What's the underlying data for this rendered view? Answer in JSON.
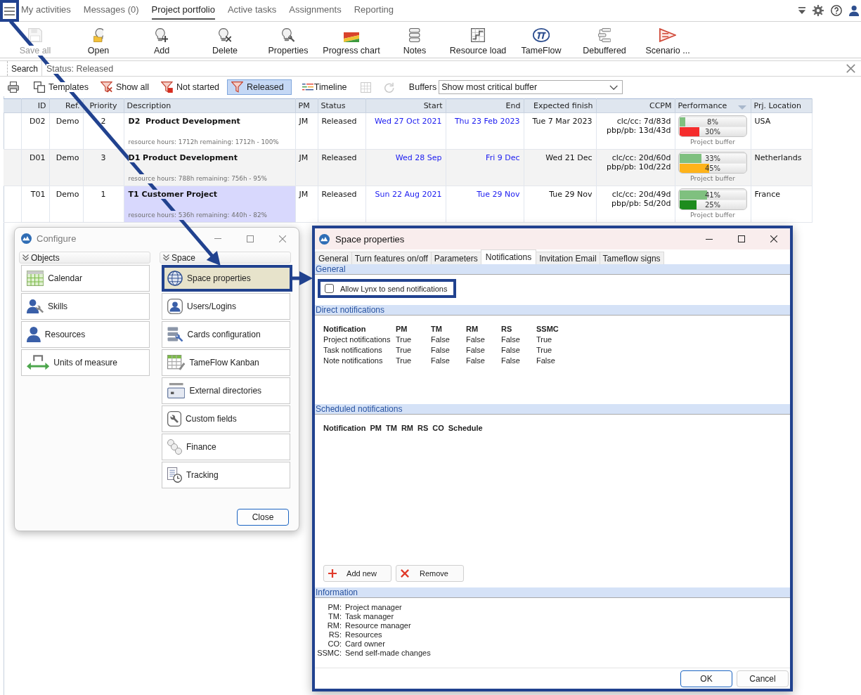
{
  "nav": {
    "menu_highlighted": true,
    "tabs": [
      {
        "label": "My activities",
        "selected": false
      },
      {
        "label": "Messages (0)",
        "selected": false
      },
      {
        "label": "Project portfolio",
        "selected": true
      },
      {
        "label": "Active tasks",
        "selected": false
      },
      {
        "label": "Assignments",
        "selected": false
      },
      {
        "label": "Reporting",
        "selected": false
      }
    ]
  },
  "toolbar": [
    {
      "kind": "save",
      "label": "Save all",
      "disabled": true
    },
    {
      "kind": "open",
      "label": "Open",
      "disabled": false
    },
    {
      "kind": "add",
      "label": "Add",
      "disabled": false
    },
    {
      "kind": "delete",
      "label": "Delete",
      "disabled": false
    },
    {
      "kind": "properties",
      "label": "Properties",
      "disabled": false
    },
    {
      "kind": "progress",
      "label": "Progress chart",
      "disabled": false
    },
    {
      "kind": "notes",
      "label": "Notes",
      "disabled": false
    },
    {
      "kind": "load",
      "label": "Resource load",
      "disabled": false
    },
    {
      "kind": "tameflow",
      "label": "TameFlow",
      "disabled": false
    },
    {
      "kind": "debuffered",
      "label": "Debuffered",
      "disabled": false
    },
    {
      "kind": "scenario",
      "label": "Scenario ...",
      "disabled": false
    }
  ],
  "search_bar": {
    "tab": "Search",
    "filter": "Status: Released"
  },
  "filter_bar": {
    "filters": [
      {
        "kind": "templates",
        "label": "Templates",
        "selected": false
      },
      {
        "kind": "show_all",
        "label": "Show all",
        "selected": false
      },
      {
        "kind": "not_started",
        "label": "Not started",
        "selected": false
      },
      {
        "kind": "released",
        "label": "Released",
        "selected": true
      }
    ],
    "views": [
      {
        "kind": "timeline",
        "label": "Timeline",
        "disabled": false
      },
      {
        "kind": "grid",
        "disabled": true
      },
      {
        "kind": "week",
        "disabled": true
      }
    ],
    "buffers": {
      "label": "Buffers",
      "value": "Show most critical buffer"
    }
  },
  "table": {
    "columns": [
      {
        "label": "ID",
        "sorted": false
      },
      {
        "label": "Ref.",
        "sorted": false
      },
      {
        "label": "Priority",
        "sorted": false
      },
      {
        "label": "Description",
        "sorted": false
      },
      {
        "label": "PM",
        "sorted": false
      },
      {
        "label": "Status",
        "sorted": false
      },
      {
        "label": "Start",
        "sorted": false
      },
      {
        "label": "End",
        "sorted": false
      },
      {
        "label": "Expected finish",
        "sorted": false
      },
      {
        "label": "CCPM",
        "sorted": false
      },
      {
        "label": "Performance",
        "sorted": true
      },
      {
        "label": "Prj. Location",
        "sorted": false
      }
    ],
    "rows": [
      {
        "selected": false,
        "id": "D02",
        "ref": "Demo",
        "priority": "2",
        "title": "D2  Product Development",
        "details": "resource hours: 1712h remaining: 1712h - 100%",
        "pm": "JM",
        "status": "Released",
        "start": "Wed 27 Oct 2021",
        "end": "Thu 23 Feb 2023",
        "expected_finish": "Tue 7 Mar 2023",
        "ccpm": [
          "clc/cc: 7d/83d",
          "pbp/pb: 13d/43d"
        ],
        "performance": {
          "progress": {
            "level": 0.08,
            "label": "8%"
          },
          "buffer": {
            "level": 0.3,
            "label": "30%",
            "color": "#f52d2d"
          },
          "caption": "Project buffer"
        },
        "location": "USA"
      },
      {
        "selected": false,
        "id": "D01",
        "ref": "Demo",
        "priority": "3",
        "title": "D1 Product Development",
        "details": "resource hours: 788h remaining: 756h - 95%",
        "pm": "JM",
        "status": "Released",
        "start": "Wed 28 Sep",
        "end": "Fri 9 Dec",
        "expected_finish": "Wed 21 Dec",
        "ccpm": [
          "clc/cc: 20d/60d",
          "pbp/pb: 10d/22d"
        ],
        "performance": {
          "progress": {
            "level": 0.33,
            "label": "33%"
          },
          "buffer": {
            "level": 0.45,
            "label": "45%",
            "color": "#ffb31a"
          },
          "caption": "Project buffer"
        },
        "location": "Netherlands"
      },
      {
        "selected": true,
        "id": "T01",
        "ref": "Demo",
        "priority": "1",
        "title": "T1 Customer Project",
        "details": "resource hours: 536h remaining: 440h - 82%",
        "pm": "JM",
        "status": "Released",
        "start": "Sun 22 Aug 2021",
        "end": "Tue 29 Nov",
        "expected_finish": "Tue 29 Nov",
        "ccpm": [
          "clc/cc: 20d/49d",
          "pbp/pb: 5d/20d"
        ],
        "performance": {
          "progress": {
            "level": 0.41,
            "label": "41%"
          },
          "buffer": {
            "level": 0.25,
            "label": "25%",
            "color": "#1e8c1e"
          },
          "caption": "Project buffer"
        },
        "location": "France"
      }
    ]
  },
  "configure": {
    "title": "Configure",
    "groups": [
      {
        "label": "Objects",
        "items": [
          {
            "kind": "calendar",
            "label": "Calendar",
            "selected": false,
            "highlighted": false
          },
          {
            "kind": "skills",
            "label": "Skills",
            "selected": false,
            "highlighted": false
          },
          {
            "kind": "resources",
            "label": "Resources",
            "selected": false,
            "highlighted": false
          },
          {
            "kind": "units",
            "label": "Units of measure",
            "selected": false,
            "highlighted": false
          }
        ]
      },
      {
        "label": "Space",
        "items": [
          {
            "kind": "globe",
            "label": "Space properties",
            "selected": true,
            "highlighted": true
          },
          {
            "kind": "users",
            "label": "Users/Logins",
            "selected": false,
            "highlighted": false
          },
          {
            "kind": "cards",
            "label": "Cards configuration",
            "selected": false,
            "highlighted": false
          },
          {
            "kind": "kanban",
            "label": "TameFlow Kanban",
            "selected": false,
            "highlighted": false
          },
          {
            "kind": "directories",
            "label": "External directories",
            "selected": false,
            "highlighted": false
          },
          {
            "kind": "fields",
            "label": "Custom fields",
            "selected": false,
            "highlighted": false
          },
          {
            "kind": "finance",
            "label": "Finance",
            "selected": false,
            "highlighted": false
          },
          {
            "kind": "tracking",
            "label": "Tracking",
            "selected": false,
            "highlighted": false
          }
        ]
      }
    ],
    "close_button": {
      "label": "Close",
      "default": true
    }
  },
  "space_dialog": {
    "title": "Space properties",
    "highlighted": true,
    "tabs": [
      {
        "label": "General",
        "selected": false
      },
      {
        "label": "Turn features on/off",
        "selected": false
      },
      {
        "label": "Parameters",
        "selected": false
      },
      {
        "label": "Notifications",
        "selected": true
      },
      {
        "label": "Invitation Email",
        "selected": false
      },
      {
        "label": "Tameflow signs",
        "selected": false
      }
    ],
    "general": {
      "heading": "General",
      "checkbox": {
        "label": "Allow Lynx to send notifications",
        "checked": false,
        "highlighted": true
      }
    },
    "direct": {
      "heading": "Direct notifications",
      "columns": [
        "Notification",
        "PM",
        "TM",
        "RM",
        "RS",
        "SSMC"
      ],
      "rows": [
        [
          "Project notifications",
          "True",
          "False",
          "False",
          "False",
          "True"
        ],
        [
          "Task notifications",
          "True",
          "False",
          "False",
          "False",
          "True"
        ],
        [
          "Note notifications",
          "True",
          "False",
          "False",
          "False",
          "False"
        ]
      ]
    },
    "scheduled": {
      "heading": "Scheduled notifications",
      "columns": [
        "Notification",
        "PM",
        "TM",
        "RM",
        "RS",
        "CO",
        "Schedule"
      ],
      "buttons": [
        {
          "kind": "add",
          "label": "Add new"
        },
        {
          "kind": "remove",
          "label": "Remove"
        }
      ]
    },
    "information": {
      "heading": "Information",
      "entries": [
        {
          "key": "PM:",
          "value": "Project manager"
        },
        {
          "key": "TM:",
          "value": "Task manager"
        },
        {
          "key": "RM:",
          "value": "Resource manager"
        },
        {
          "key": "RS:",
          "value": "Resources"
        },
        {
          "key": "CO:",
          "value": "Card owner"
        },
        {
          "key": "SSMC:",
          "value": "Send self-made changes"
        }
      ]
    },
    "buttons": [
      {
        "label": "OK",
        "default": true
      },
      {
        "label": "Cancel",
        "default": false
      }
    ]
  }
}
